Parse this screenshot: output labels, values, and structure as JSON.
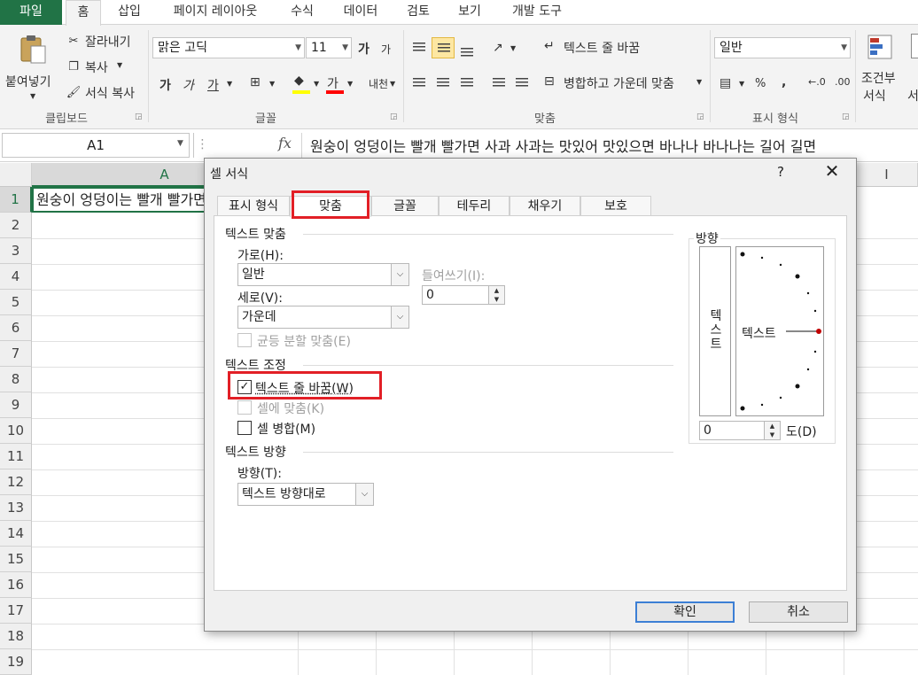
{
  "ribbon_tabs": [
    {
      "label": "파일"
    },
    {
      "label": "홈"
    },
    {
      "label": "삽입"
    },
    {
      "label": "페이지 레이아웃"
    },
    {
      "label": "수식"
    },
    {
      "label": "데이터"
    },
    {
      "label": "검토"
    },
    {
      "label": "보기"
    },
    {
      "label": "개발 도구"
    }
  ],
  "clipboard": {
    "paste": "붙여넣기",
    "cut": "잘라내기",
    "copy": "복사",
    "format_painter": "서식 복사",
    "group": "클립보드"
  },
  "font": {
    "font_name": "맑은 고딕",
    "font_size": "11",
    "grow": "가",
    "shrink": "가",
    "bold": "가",
    "italic": "가",
    "underline": "가",
    "font_color_glyph": "가",
    "phonetic": "내천",
    "group": "글꼴"
  },
  "alignment": {
    "wrap_text": "텍스트 줄 바꿈",
    "merge_center": "병합하고 가운데 맞춤",
    "group": "맞춤"
  },
  "number": {
    "format": "일반",
    "percent": "%",
    "comma": ",",
    "group": "표시 형식"
  },
  "styles": {
    "conditional_line1": "조건부",
    "conditional_line2": "서식",
    "format_as_table_line2": "서"
  },
  "formula_bar": {
    "name_box": "A1",
    "fx": "fx",
    "content": "원숭이 엉덩이는 빨개 빨가면 사과 사과는 맛있어 맛있으면 바나나 바나나는 길어 길면"
  },
  "sheet": {
    "columns": [
      "A",
      "I"
    ],
    "rows": [
      "1",
      "2",
      "3",
      "4",
      "5",
      "6",
      "7",
      "8",
      "9",
      "10",
      "11",
      "12",
      "13",
      "14",
      "15",
      "16",
      "17",
      "18",
      "19"
    ],
    "cell_A1": "원숭이 엉덩이는 빨개 빨가면"
  },
  "dialog": {
    "title": "셀 서식",
    "help": "?",
    "close": "✕",
    "tabs": [
      "표시 형식",
      "맞춤",
      "글꼴",
      "테두리",
      "채우기",
      "보호"
    ],
    "text_alignment_title": "텍스트 맞춤",
    "horizontal_label": "가로(H):",
    "horizontal_value": "일반",
    "indent_label": "들여쓰기(I):",
    "indent_value": "0",
    "vertical_label": "세로(V):",
    "vertical_value": "가운데",
    "justify_distributed": "균등 분할 맞춤(E)",
    "text_control_title": "텍스트 조정",
    "wrap_text": "텍스트 줄 바꿈(W)",
    "wrap_text_checked": true,
    "shrink_to_fit": "셀에 맞춤(K)",
    "merge_cells": "셀 병합(M)",
    "direction_title": "텍스트 방향",
    "direction_label": "방향(T):",
    "direction_value": "텍스트 방향대로",
    "orientation_title": "방향",
    "orientation_vertical_text": "텍스트",
    "orientation_dial_text": "텍스트",
    "degrees_value": "0",
    "degrees_label": "도(D)",
    "ok": "확인",
    "cancel": "취소",
    "highlight_color": "#e21f26"
  },
  "colors": {
    "excel_green": "#217346",
    "ribbon_bg": "#f3f3f3",
    "selected_align_bg": "#fde7a2"
  }
}
